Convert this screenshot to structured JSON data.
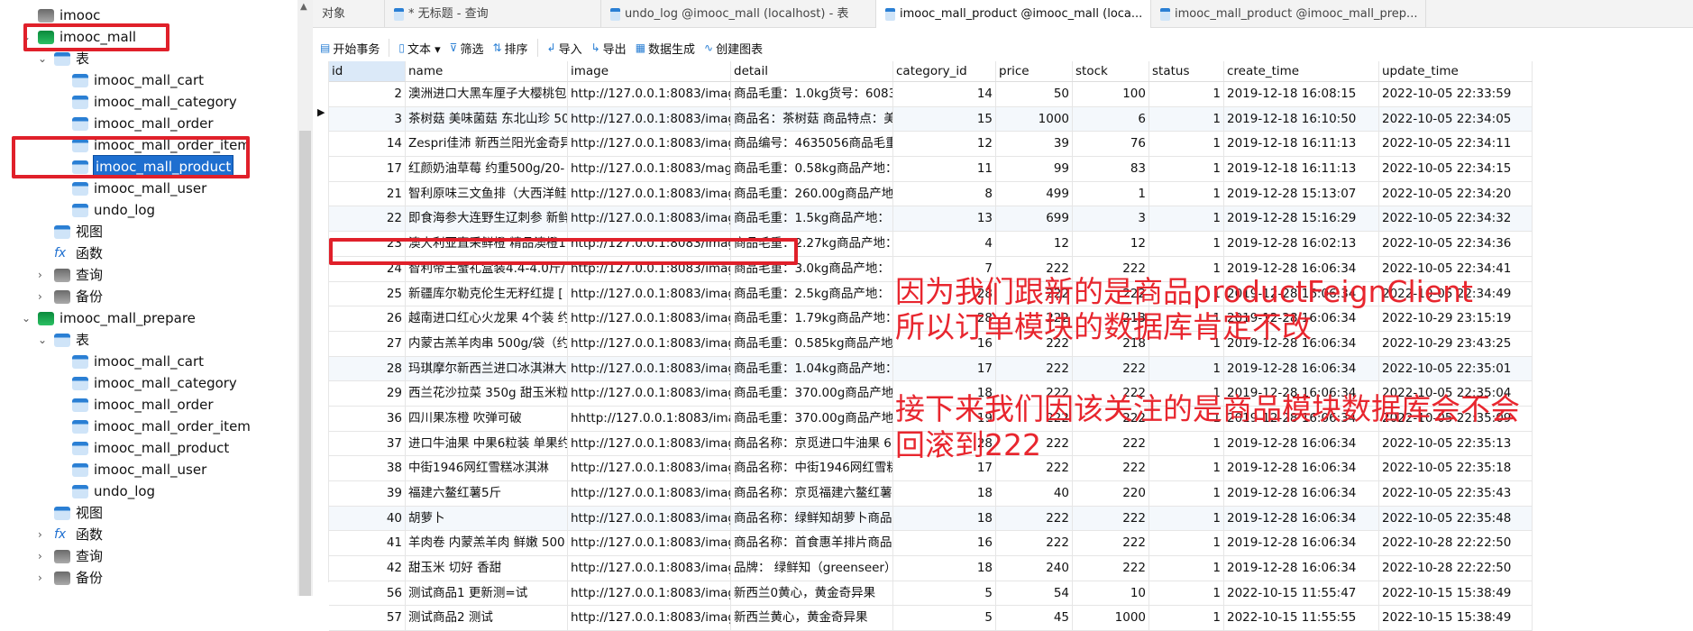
{
  "sidebar": {
    "items": [
      {
        "label": "imooc",
        "icon": "database-gray",
        "level": 0
      },
      {
        "label": "imooc_mall",
        "icon": "database-green",
        "level": 0,
        "open": true
      },
      {
        "label": "表",
        "icon": "tables",
        "level": 1,
        "open": true
      },
      {
        "label": "imooc_mall_cart",
        "icon": "table",
        "level": 2
      },
      {
        "label": "imooc_mall_category",
        "icon": "table",
        "level": 2
      },
      {
        "label": "imooc_mall_order",
        "icon": "table",
        "level": 2
      },
      {
        "label": "imooc_mall_order_item",
        "icon": "table",
        "level": 2
      },
      {
        "label": "imooc_mall_product",
        "icon": "table",
        "level": 2,
        "selected": true
      },
      {
        "label": "imooc_mall_user",
        "icon": "table",
        "level": 2
      },
      {
        "label": "undo_log",
        "icon": "table",
        "level": 2
      },
      {
        "label": "视图",
        "icon": "view",
        "level": 1
      },
      {
        "label": "函数",
        "icon": "function",
        "level": 1
      },
      {
        "label": "查询",
        "icon": "query",
        "level": 1,
        "closed": true
      },
      {
        "label": "备份",
        "icon": "backup",
        "level": 1,
        "closed": true
      },
      {
        "label": "imooc_mall_prepare",
        "icon": "database-green",
        "level": 0,
        "open": true
      },
      {
        "label": "表",
        "icon": "tables",
        "level": 1,
        "open": true
      },
      {
        "label": "imooc_mall_cart",
        "icon": "table",
        "level": 2
      },
      {
        "label": "imooc_mall_category",
        "icon": "table",
        "level": 2
      },
      {
        "label": "imooc_mall_order",
        "icon": "table",
        "level": 2
      },
      {
        "label": "imooc_mall_order_item",
        "icon": "table",
        "level": 2
      },
      {
        "label": "imooc_mall_product",
        "icon": "table",
        "level": 2
      },
      {
        "label": "imooc_mall_user",
        "icon": "table",
        "level": 2
      },
      {
        "label": "undo_log",
        "icon": "table",
        "level": 2
      },
      {
        "label": "视图",
        "icon": "view",
        "level": 1
      },
      {
        "label": "函数",
        "icon": "function",
        "level": 1,
        "closed": true
      },
      {
        "label": "查询",
        "icon": "query",
        "level": 1,
        "closed": true
      },
      {
        "label": "备份",
        "icon": "backup",
        "level": 1,
        "closed": true
      }
    ]
  },
  "tabs": [
    {
      "label": "对象",
      "w": 80
    },
    {
      "label": "* 无标题 - 查询",
      "w": 240
    },
    {
      "label": "undo_log @imooc_mall (localhost) - 表",
      "w": 305
    },
    {
      "label": "imooc_mall_product @imooc_mall (loca...",
      "w": 305,
      "active": true
    },
    {
      "label": "imooc_mall_product @imooc_mall_prep...",
      "w": 305
    }
  ],
  "toolbar": [
    "开始事务",
    "文本 ▾",
    "筛选",
    "排序",
    "导入",
    "导出",
    "数据生成",
    "创建图表"
  ],
  "table": {
    "columns": [
      "id",
      "name",
      "image",
      "detail",
      "category_id",
      "price",
      "stock",
      "status",
      "create_time",
      "update_time"
    ],
    "rows": [
      [
        "2",
        "澳洲进口大黑车厘子大樱桃包",
        "http://127.0.0.1:8083/image",
        "商品毛重：1.0kg货号：6083",
        "14",
        "50",
        "100",
        "1",
        "2019-12-18 16:08:15",
        "2022-10-05 22:33:59"
      ],
      [
        "3",
        "茶树菇 美味菌菇 东北山珍 500",
        "http://127.0.0.1:8083/image",
        "商品名：茶树菇 商品特点：美",
        "15",
        "1000",
        "6",
        "1",
        "2019-12-18 16:10:50",
        "2022-10-05 22:34:05"
      ],
      [
        "14",
        "Zespri佳沛 新西兰阳光金奇异",
        "http://127.0.0.1:8083/image",
        "商品编号：4635056商品毛重",
        "12",
        "39",
        "76",
        "1",
        "2019-12-18 16:11:13",
        "2022-10-05 22:34:11"
      ],
      [
        "17",
        "红颜奶油草莓 约重500g/20-",
        "http://127.0.0.1:8083/mage",
        "商品毛重：0.58kg商品产地：",
        "11",
        "99",
        "83",
        "1",
        "2019-12-18 16:11:13",
        "2022-10-05 22:34:15"
      ],
      [
        "21",
        "智利原味三文鱼排（大西洋鲑",
        "http://127.0.0.1:8083/image",
        "商品毛重：260.00g商品产地",
        "8",
        "499",
        "1",
        "1",
        "2019-12-28 15:13:07",
        "2022-10-05 22:34:20"
      ],
      [
        "22",
        "即食海参大连野生辽刺参 新鲜",
        "http://127.0.0.1:8083/image",
        "商品毛重：1.5kg商品产地：",
        "13",
        "699",
        "3",
        "1",
        "2019-12-28 15:16:29",
        "2022-10-05 22:34:32"
      ],
      [
        "23",
        "澳大利亚直采鲜橙 精品澳橙1",
        "http://127.0.0.1:8083/image",
        "商品毛重：2.27kg商品产地：",
        "4",
        "12",
        "12",
        "1",
        "2019-12-28 16:02:13",
        "2022-10-05 22:34:36"
      ],
      [
        "24",
        "智利帝王蟹礼盒装4.4-4.0斤/",
        "http://127.0.0.1:8083/image",
        "商品毛重：3.0kg商品产地：",
        "7",
        "222",
        "222",
        "1",
        "2019-12-28 16:06:34",
        "2022-10-05 22:34:41"
      ],
      [
        "25",
        "新疆库尔勒克伦生无籽红提 [",
        "http://127.0.0.1:8083/image",
        "商品毛重：2.5kg商品产地：",
        "28",
        "222",
        "222",
        "1",
        "2019-12-28 16:06:34",
        "2022-10-05 22:34:49"
      ],
      [
        "26",
        "越南进口红心火龙果 4个装 约",
        "http://127.0.0.1:8083/image",
        "商品毛重：1.79kg商品产地：",
        "28",
        "222",
        "213",
        "1",
        "2019-12-28 16:06:34",
        "2022-10-29 23:15:19"
      ],
      [
        "27",
        "内蒙古羔羊肉串 500g/袋（约",
        "http://127.0.0.1:8083/image",
        "商品毛重：0.585kg商品产地",
        "16",
        "222",
        "218",
        "1",
        "2019-12-28 16:06:34",
        "2022-10-29 23:43:25"
      ],
      [
        "28",
        "玛琪摩尔新西兰进口冰淇淋大",
        "http://127.0.0.1:8083/image",
        "商品毛重：1.04kg商品产地：",
        "17",
        "222",
        "222",
        "1",
        "2019-12-28 16:06:34",
        "2022-10-05 22:35:01"
      ],
      [
        "29",
        "西兰花沙拉菜 350g 甜玉米粒",
        "http://127.0.0.1:8083/image",
        "商品毛重：370.00g商品产地",
        "18",
        "222",
        "222",
        "1",
        "2019-12-28 16:06:34",
        "2022-10-05 22:35:04"
      ],
      [
        "36",
        "四川果冻橙 吹弹可破",
        "hhttp://127.0.0.1:8083/imag",
        "商品毛重：370.00g商品产地",
        "19",
        "222",
        "222",
        "1",
        "2019-12-28 16:06:34",
        "2022-10-05 22:35:09"
      ],
      [
        "37",
        "进口牛油果 中果6粒装 单果约",
        "http://127.0.0.1:8083/image",
        "商品名称：京觅进口牛油果 6",
        "28",
        "222",
        "222",
        "1",
        "2019-12-28 16:06:34",
        "2022-10-05 22:35:13"
      ],
      [
        "38",
        "中街1946网红雪糕冰淇淋",
        "http://127.0.0.1:8083/image",
        "商品名称：中街1946网红雪糕",
        "17",
        "222",
        "222",
        "1",
        "2019-12-28 16:06:34",
        "2022-10-05 22:35:18"
      ],
      [
        "39",
        "福建六鳌红薯5斤",
        "http://127.0.0.1:8083/image",
        "商品名称：京觅福建六鳌红薯",
        "18",
        "40",
        "220",
        "1",
        "2019-12-28 16:06:34",
        "2022-10-05 22:35:43"
      ],
      [
        "40",
        "胡萝卜",
        "http://127.0.0.1:8083/image",
        "商品名称：绿鲜知胡萝卜商品",
        "18",
        "222",
        "222",
        "1",
        "2019-12-28 16:06:34",
        "2022-10-05 22:35:48"
      ],
      [
        "41",
        "羊肉卷 内蒙羔羊肉 鲜嫩 500",
        "http://127.0.0.1:8083/image",
        "商品名称：首食惠羊排片商品",
        "16",
        "222",
        "222",
        "1",
        "2019-12-28 16:06:34",
        "2022-10-28 22:22:50"
      ],
      [
        "42",
        "甜玉米 切好 香甜",
        "http://127.0.0.1:8083/image",
        "品牌： 绿鲜知（greenseer）",
        "18",
        "240",
        "222",
        "1",
        "2019-12-28 16:06:34",
        "2022-10-28 22:22:50"
      ],
      [
        "56",
        "测试商品1 更新测=试",
        "http://127.0.0.1:8083/image",
        "新西兰0黄心，黄金奇异果",
        "5",
        "54",
        "10",
        "1",
        "2022-10-15 11:55:47",
        "2022-10-15 15:38:49"
      ],
      [
        "57",
        "测试商品2 测试",
        "http://127.0.0.1:8083/image",
        "新西兰黄心，黄金奇异果",
        "5",
        "45",
        "1000",
        "1",
        "2022-10-15 11:55:55",
        "2022-10-15 15:38:49"
      ]
    ]
  },
  "annotations": [
    "因为我们跟新的是商品productFeignClient",
    "所以订单模块的数据库肯定不改",
    "接下来我们因该关注的是商品模块数据库会不会",
    "回滚到222"
  ],
  "colors": {
    "highlight": "#e0202a",
    "annotation": "#e8262e",
    "selection": "#1e6fd0"
  }
}
